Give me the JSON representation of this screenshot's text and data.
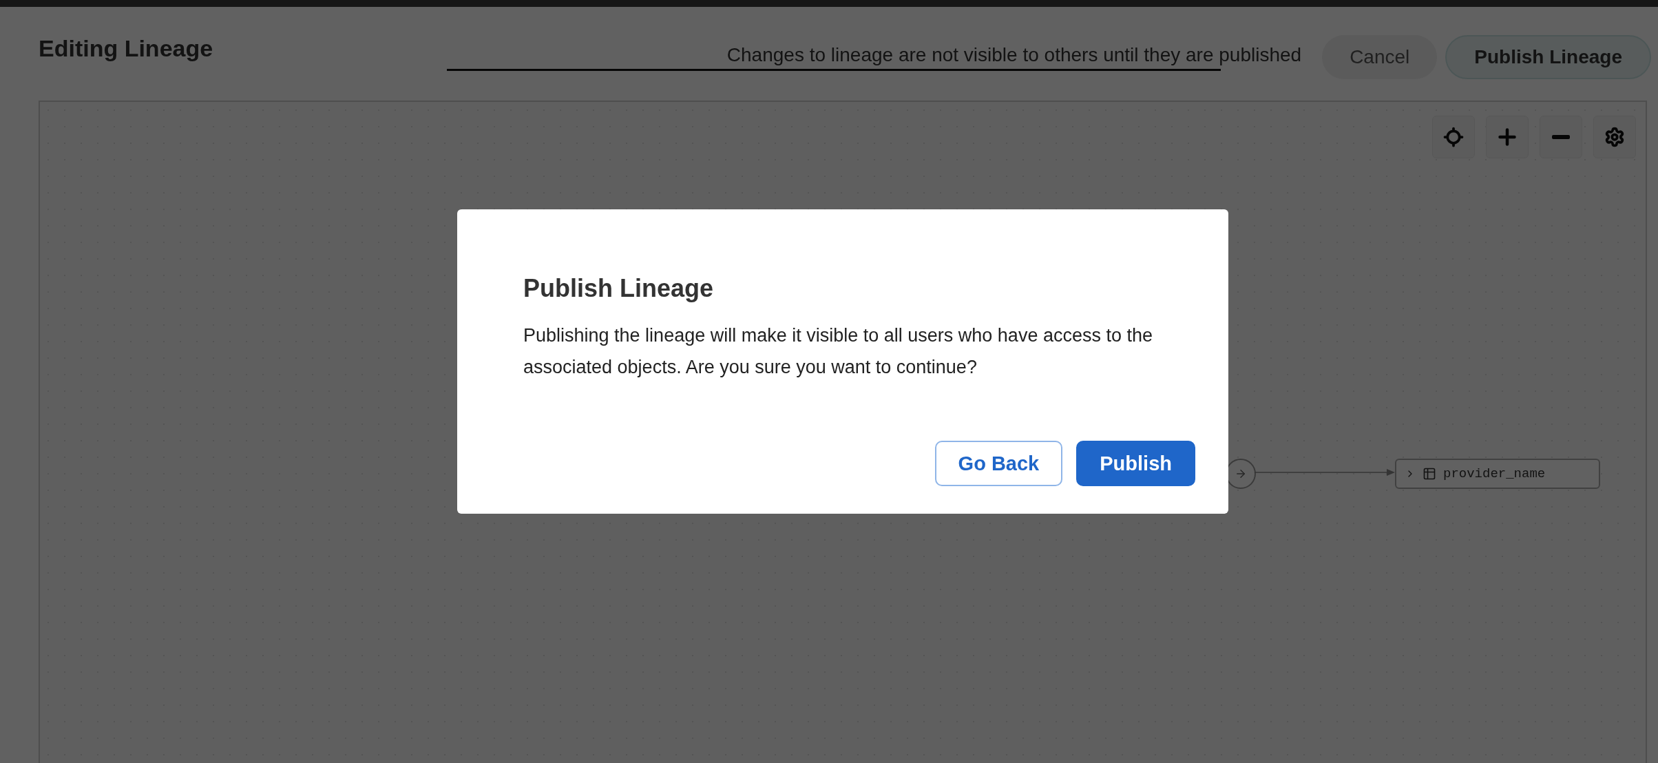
{
  "header": {
    "title": "Editing Lineage",
    "notice": "Changes to lineage are not visible to others until they are published",
    "buttons": [
      {
        "label": "Cancel",
        "kind": "secondary"
      },
      {
        "label": "Publish Lineage",
        "kind": "primary"
      }
    ]
  },
  "canvas": {
    "toolbar": [
      {
        "kind": "recenter"
      },
      {
        "kind": "zoom_in"
      },
      {
        "kind": "zoom_out"
      },
      {
        "kind": "settings"
      }
    ],
    "nodes": [
      {
        "label": "provider_name",
        "expanded": false
      }
    ]
  },
  "dialog": {
    "title": "Publish Lineage",
    "message": "Publishing the lineage will make it visible to all users who have access to the associated objects. Are you sure you want to continue?",
    "buttons": [
      {
        "label": "Go Back",
        "kind": "secondary"
      },
      {
        "label": "Publish",
        "kind": "primary"
      }
    ]
  }
}
